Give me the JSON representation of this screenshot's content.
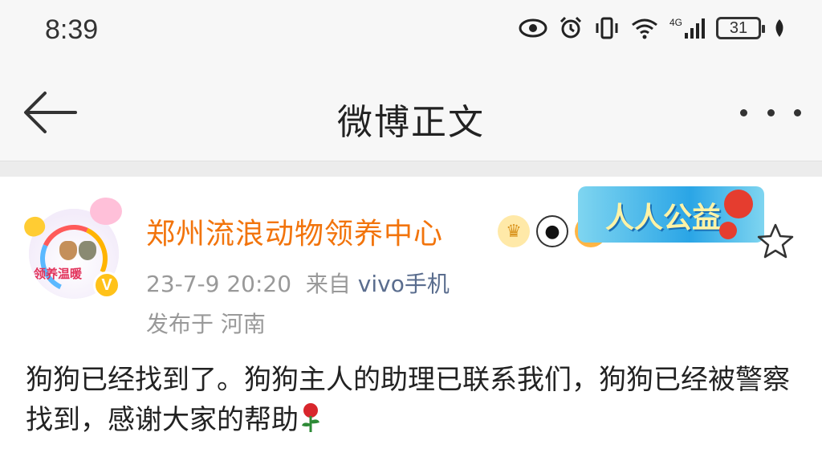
{
  "status_bar": {
    "time": "8:39",
    "network": "4G",
    "battery": "31",
    "icons": [
      "eye-icon",
      "alarm-icon",
      "vibrate-icon",
      "wifi-icon",
      "signal-icon",
      "battery-icon",
      "leaf-icon"
    ]
  },
  "header": {
    "title": "微博正文",
    "back_icon": "arrow-left-icon",
    "more_icon": "more-dots-icon"
  },
  "post": {
    "author": {
      "name": "郑州流浪动物领养中心",
      "avatar_text": "领养温暖",
      "verified_symbol": "V",
      "badges": [
        "crown-badge-icon",
        "panda-badge-icon",
        "pufferfish-badge-icon"
      ],
      "charity_banner_text": "人人公益"
    },
    "date": "23-7-9 20:20",
    "source_prefix": "来自",
    "source": "vivo手机",
    "location": "发布于 河南",
    "body": "狗狗已经找到了。狗狗主人的助理已联系我们，狗狗已经被警察找到，感谢大家的帮助",
    "body_emoji": "rose-icon"
  },
  "colors": {
    "username": "#f2740c",
    "meta": "#999999",
    "source_link": "#5a6d8e",
    "verified": "#ffc21a",
    "background": "#f7f7f7"
  }
}
